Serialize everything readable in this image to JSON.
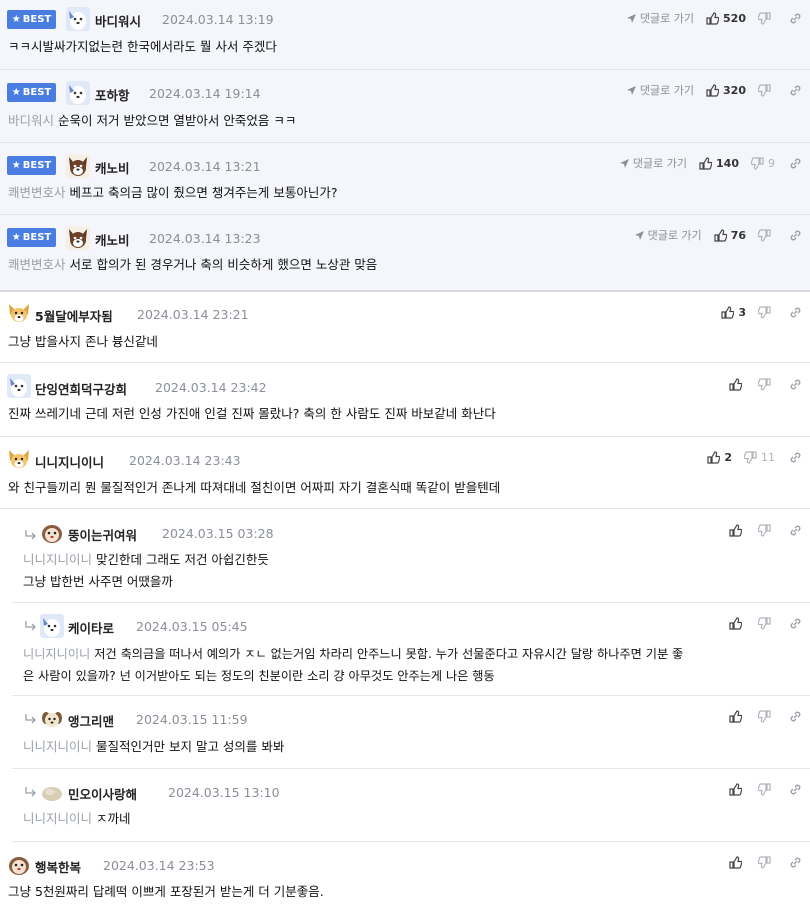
{
  "labels": {
    "best": "BEST",
    "goto_parent": "댓글로 가기"
  },
  "best_comments": [
    {
      "nick": "바디워시",
      "date": "2024.03.14 13:19",
      "mention": "",
      "text": "ㅋㅋ시발싸가지없는련 한국에서라도 뭘 사서 주겠다",
      "up": "520",
      "down": "",
      "avatar": "white-dog-icon"
    },
    {
      "nick": "포하항",
      "date": "2024.03.14 19:14",
      "mention": "바디워시",
      "text": "순욱이 저거 받았으면 열받아서 안죽었음 ㅋㅋ",
      "up": "320",
      "down": "",
      "avatar": "white-dog-icon"
    },
    {
      "nick": "캐노비",
      "date": "2024.03.14 13:21",
      "mention": "쾌변변호사",
      "text": "베프고 축의금 많이 줬으면 챙겨주는게 보통아닌가?",
      "up": "140",
      "down": "9",
      "avatar": "shiba-icon"
    },
    {
      "nick": "캐노비",
      "date": "2024.03.14 13:23",
      "mention": "쾌변변호사",
      "text": "서로 합의가 된 경우거나 축의 비슷하게 했으면 노상관 맞음",
      "up": "76",
      "down": "",
      "avatar": "shiba-icon"
    }
  ],
  "comments": [
    {
      "nick": "5월달에부자됨",
      "date": "2024.03.14 23:21",
      "mention": "",
      "lines": [
        "그냥 밥을사지 존나 븅신같네"
      ],
      "up": "3",
      "down": "",
      "avatar": "fox-icon"
    },
    {
      "nick": "단잉연희덕구강희",
      "date": "2024.03.14 23:42",
      "mention": "",
      "lines": [
        "진짜 쓰레기네 근데 저런 인성 가진애 인걸 진짜 몰랐나? 축의 한 사람도 진짜 바보같네 화난다"
      ],
      "up": "",
      "down": "",
      "avatar": "white-dog-icon"
    },
    {
      "nick": "니니지니이니",
      "date": "2024.03.14 23:43",
      "mention": "",
      "lines": [
        "와 친구들끼리 뭔 물질적인거 존나게 따져대네 절친이면 어짜피 자기 결혼식때 똑같이 받을텐데"
      ],
      "up": "2",
      "down": "11",
      "avatar": "fox-icon"
    },
    {
      "nick": "뚱이는귀여워",
      "date": "2024.03.15 03:28",
      "mention": "니니지니이니",
      "lines": [
        "맞긴한데 그래도 저건 아쉽긴한듯",
        "그냥 밥한번 사주면 어땠을까"
      ],
      "up": "",
      "down": "",
      "avatar": "puppy-icon",
      "reply": true
    },
    {
      "nick": "케이타로",
      "date": "2024.03.15 05:45",
      "mention": "니니지니이니",
      "lines": [
        "저건 축의금을 떠나서 예의가 ㅈㄴ 없는거임 차라리 안주느니 못함. 누가 선물준다고 자유시간 달랑 하나주면 기분 좋",
        "은 사람이 있을까? 넌 이거받아도 되는 정도의 친분이란 소리 걍 아무것도 안주는게 나은 행동"
      ],
      "up": "",
      "down": "",
      "avatar": "white-dog-icon",
      "reply": true
    },
    {
      "nick": "앵그리맨",
      "date": "2024.03.15 11:59",
      "mention": "니니지니이니",
      "lines": [
        "물질적인거만 보지 말고 성의를 봐봐"
      ],
      "up": "",
      "down": "",
      "avatar": "small-dog-icon",
      "reply": true
    },
    {
      "nick": "민오이사랑해",
      "date": "2024.03.15 13:10",
      "mention": "니니지니이니",
      "lines": [
        "ㅈ까네"
      ],
      "up": "",
      "down": "",
      "avatar": "blob-icon",
      "reply": true
    },
    {
      "nick": "행복한복",
      "date": "2024.03.14 23:53",
      "mention": "",
      "lines": [
        "그냥 5천원짜리 답례떡 이쁘게 포장된거 받는게 더 기분좋음."
      ],
      "up": "",
      "down": "",
      "avatar": "puppy-icon"
    }
  ]
}
